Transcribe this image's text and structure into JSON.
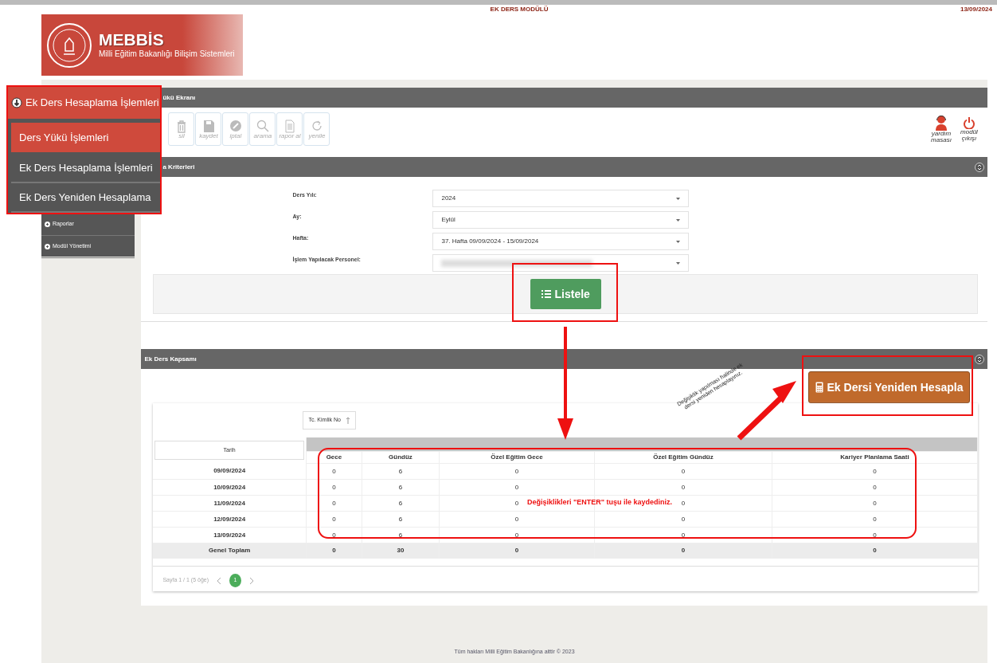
{
  "header": {
    "logo_title": "MEBBİS",
    "logo_subtitle": "Milli Eğitim Bakanlığı Bilişim Sistemleri",
    "module": "EK DERS MODÜLÜ",
    "date": "13/09/2024"
  },
  "sidebar": {
    "items": [
      {
        "label": "Raporlar"
      },
      {
        "label": "Modül Yönetimi"
      }
    ]
  },
  "menu_callout": {
    "title": "Ek Ders Hesaplama İşlemleri",
    "expanded": true,
    "items": [
      {
        "label": "Ders Yükü İşlemleri",
        "selected": true
      },
      {
        "label": "Ek Ders Hesaplama İşlemleri",
        "selected": false
      },
      {
        "label": "Ek Ders Yeniden Hesaplama",
        "selected": false
      }
    ]
  },
  "screen_panel": {
    "title": "ükü Ekranı",
    "toolbar": [
      {
        "kind": "trash",
        "label": "sil",
        "disabled": true
      },
      {
        "kind": "save",
        "label": "kaydet",
        "disabled": true
      },
      {
        "kind": "cancel",
        "label": "iptal",
        "disabled": true
      },
      {
        "kind": "search",
        "label": "arama",
        "disabled": true
      },
      {
        "kind": "report",
        "label": "rapor al",
        "disabled": true
      },
      {
        "kind": "refresh",
        "label": "yenile",
        "disabled": true
      }
    ],
    "right_tools": [
      {
        "kind": "help",
        "label": "yardım masası"
      },
      {
        "kind": "exit",
        "label": "modül çıkışı"
      }
    ]
  },
  "criteria_panel": {
    "title": "a Kriterleri",
    "fields": [
      {
        "label": "Ders Yılı:",
        "value": "2024",
        "redacted": false
      },
      {
        "label": "Ay:",
        "value": "Eylül",
        "redacted": false
      },
      {
        "label": "Hafta:",
        "value": "37. Hafta 09/09/2024 - 15/09/2024",
        "redacted": false
      },
      {
        "label": "İşlem Yapılacak Personel:",
        "redacted": true
      }
    ],
    "list_button": "Listele"
  },
  "scope_panel": {
    "title": "Ek Ders Kapsamı",
    "recalc_button": "Ek Dersi Yeniden Hesapla",
    "group_chip": "Tc. Kimlik No",
    "row_header": "Tarih",
    "columns": [
      "Gece",
      "Gündüz",
      "Özel Eğitim Gece",
      "Özel Eğitim Gündüz",
      "Kariyer Planlama Saati"
    ],
    "rows": [
      {
        "date": "09/09/2024",
        "values": [
          "0",
          "6",
          "0",
          "0",
          "0"
        ]
      },
      {
        "date": "10/09/2024",
        "values": [
          "0",
          "6",
          "0",
          "0",
          "0"
        ]
      },
      {
        "date": "11/09/2024",
        "values": [
          "0",
          "6",
          "0",
          "0",
          "0"
        ]
      },
      {
        "date": "12/09/2024",
        "values": [
          "0",
          "6",
          "0",
          "0",
          "0"
        ]
      },
      {
        "date": "13/09/2024",
        "values": [
          "0",
          "6",
          "0",
          "0",
          "0"
        ]
      }
    ],
    "total": {
      "label": "Genel Toplam",
      "values": [
        "0",
        "30",
        "0",
        "0",
        "0"
      ]
    },
    "pager": {
      "summary": "Sayfa 1 / 1 (5 öğe)",
      "pages": [
        {
          "label": "1",
          "selected": true
        }
      ]
    }
  },
  "annotations": {
    "enter_note": "Değişiklikleri \"ENTER\" tuşu ile kaydediniz.",
    "recalc_note": "Değişiklik yapılması halinde ek dersi yeniden hesaplayınız."
  },
  "footer": "Tüm hakları Milli Eğitim Bakanlığına aittir © 2023"
}
